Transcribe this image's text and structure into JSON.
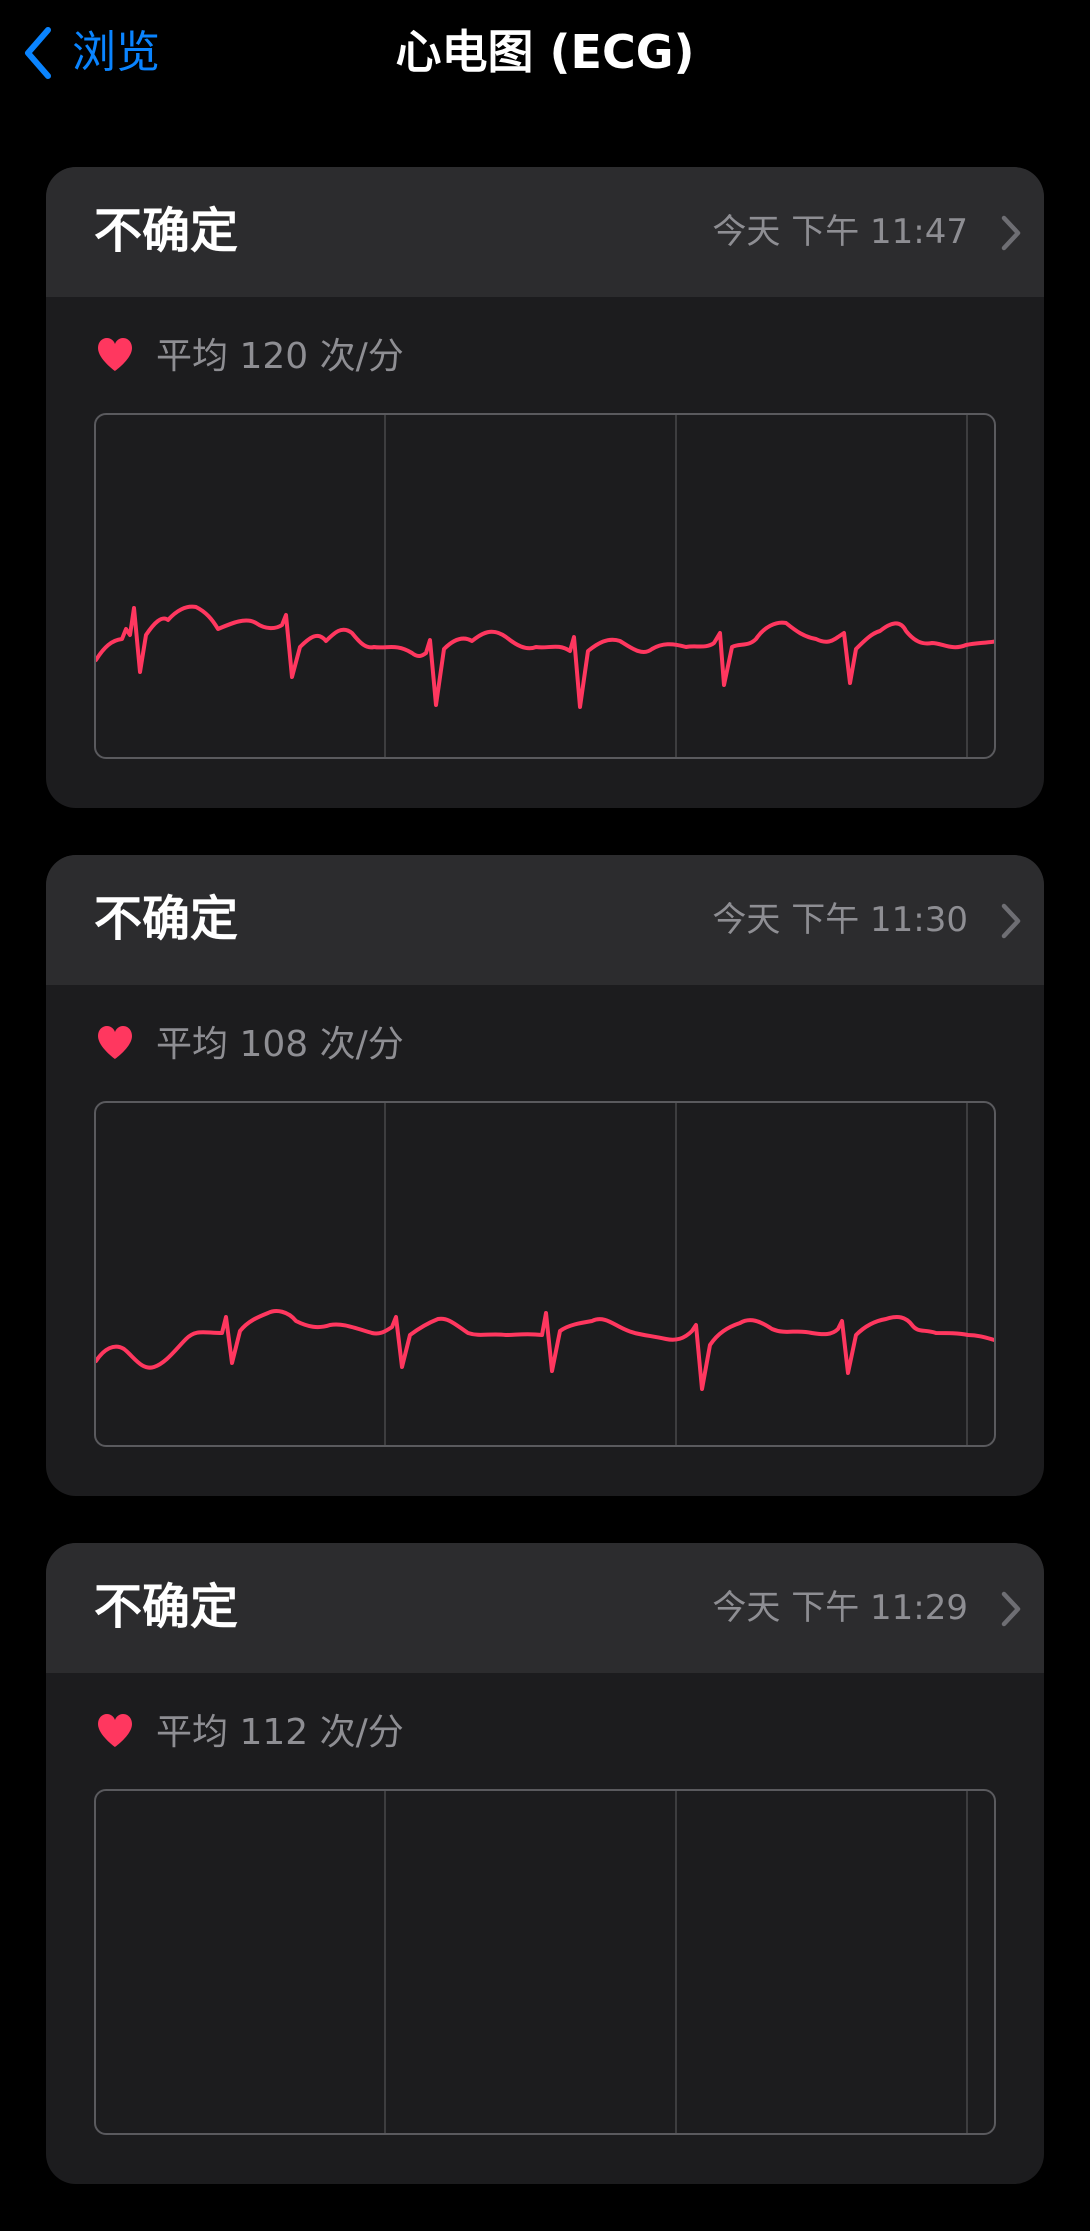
{
  "nav": {
    "back_label": "浏览",
    "title": "心电图 (ECG)"
  },
  "records": [
    {
      "classification": "不确定",
      "time": "今天 下午 11:47",
      "avg_bpm_label": "平均 120 次/分"
    },
    {
      "classification": "不确定",
      "time": "今天 下午 11:30",
      "avg_bpm_label": "平均 108 次/分"
    },
    {
      "classification": "不确定",
      "time": "今天 下午 11:29",
      "avg_bpm_label": "平均 112 次/分"
    }
  ],
  "colors": {
    "accent": "#0a84ff",
    "trace": "#ff375f",
    "heart": "#ff375f",
    "card_bg": "#1c1c1e",
    "card_header_bg": "#2c2c2e",
    "secondary_text": "#8e8e93"
  },
  "icons": {
    "back": "chevron-left-icon",
    "heart": "heart-icon",
    "disclosure": "chevron-right-icon"
  }
}
